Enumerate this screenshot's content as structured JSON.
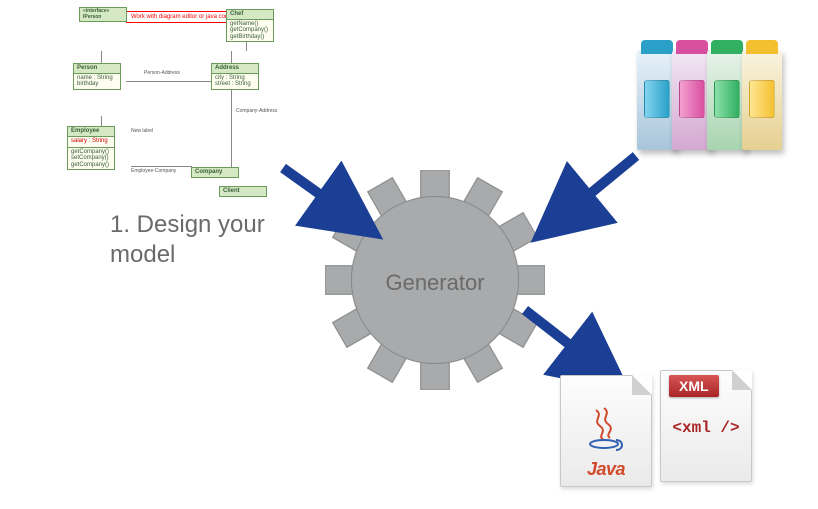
{
  "diagram": {
    "step_label": "1. Design your\nmodel",
    "generator_label": "Generator",
    "uml_note": "Work with diagram editor\nor java code",
    "uml_classes": {
      "iperson": "IPerson",
      "person": "Person",
      "address": "Address",
      "chef": "Chef",
      "employee": "Employee",
      "company": "Company",
      "client": "Client"
    },
    "uml_relations": {
      "person_address": "Person-Address",
      "company_address": "Company-Address",
      "employee_company": "Employee-Company",
      "new_label": "New label"
    },
    "uml_attrs": {
      "person": [
        "name : String",
        "birthday"
      ],
      "address": [
        "city : String",
        "street : String"
      ],
      "employee": [
        "salary : String"
      ],
      "employee_ops": [
        "getCompany()",
        "setCompany()",
        "getCompany()"
      ],
      "chef_ops": [
        "getName()",
        "getCompany()",
        "getBirthday()"
      ]
    },
    "outputs": {
      "java": "Java",
      "xml_badge": "XML",
      "xml_tag": "<xml />"
    },
    "cartridge_colors": [
      "#2aa0c8",
      "#d94fa0",
      "#30b060",
      "#f4c030"
    ]
  }
}
